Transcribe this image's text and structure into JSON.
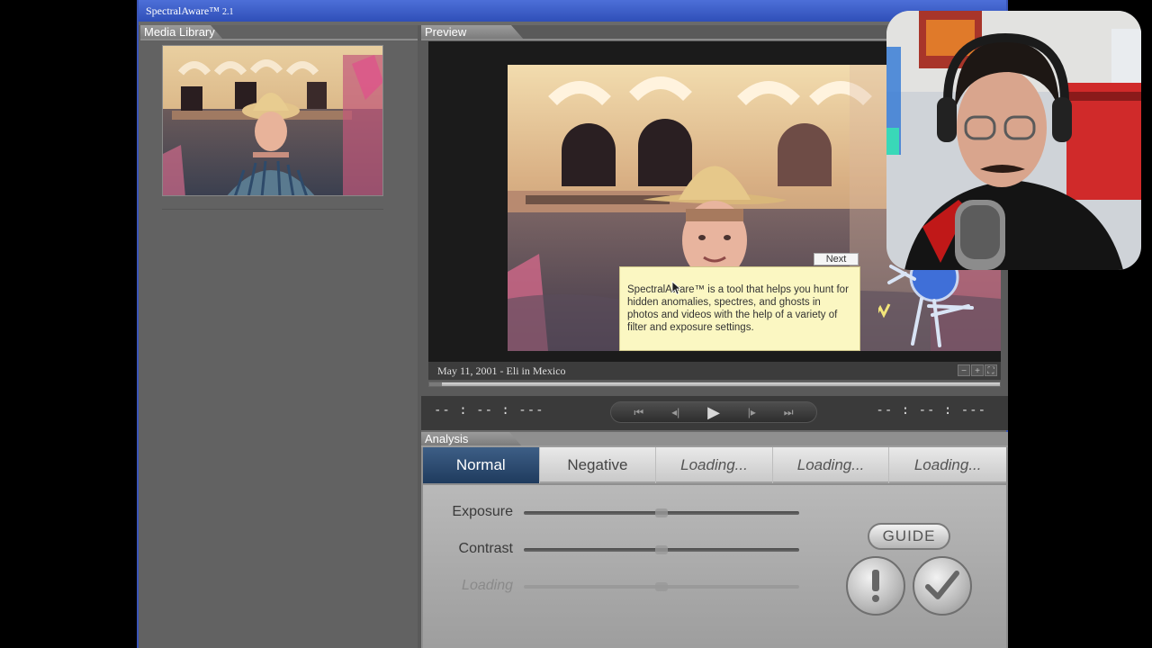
{
  "window": {
    "title": "SpectralAware™",
    "version": "2.1"
  },
  "library": {
    "header": "Media Library"
  },
  "preview": {
    "header": "Preview",
    "caption": "May 11, 2001 - Eli in Mexico",
    "time_left": "-- : -- : ---",
    "time_right": "-- : -- : ---"
  },
  "tooltip": {
    "next_label": "Next",
    "text": "SpectralAware™ is a tool that helps you hunt for hidden anomalies, spectres, and ghosts in photos and videos with the help of a variety of filter and exposure settings."
  },
  "analysis": {
    "header": "Analysis",
    "modes": [
      {
        "label": "Normal"
      },
      {
        "label": "Negative"
      },
      {
        "label": "Loading..."
      },
      {
        "label": "Loading..."
      },
      {
        "label": "Loading..."
      }
    ],
    "sliders": [
      {
        "label": "Exposure"
      },
      {
        "label": "Contrast"
      },
      {
        "label": "Loading"
      }
    ],
    "guide_label": "GUIDE"
  },
  "icons": [
    "rewind-icon",
    "step-back-icon",
    "play-icon",
    "step-forward-icon",
    "fast-forward-icon",
    "warning-icon",
    "checkmark-icon",
    "zoom-out-icon",
    "zoom-in-icon",
    "fullscreen-icon"
  ]
}
